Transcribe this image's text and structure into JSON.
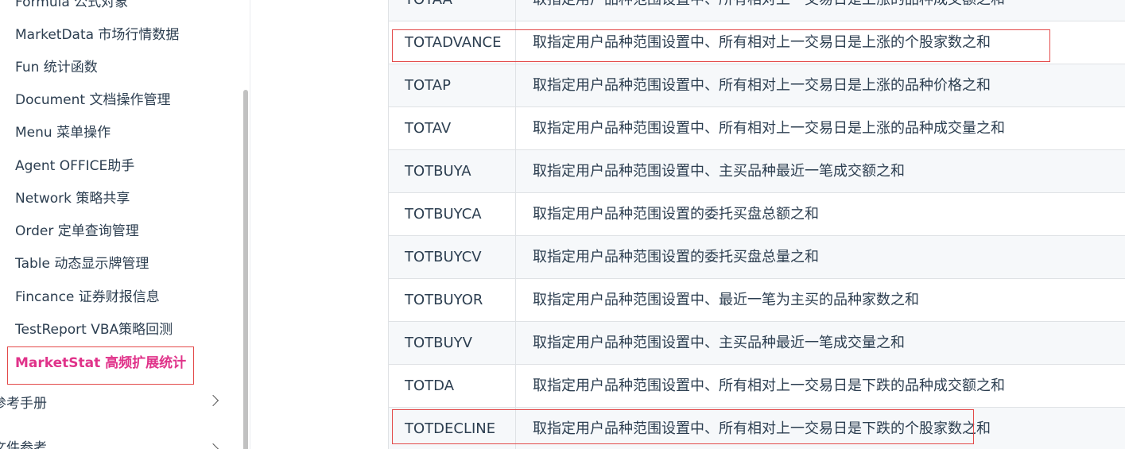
{
  "sidebar": {
    "items": [
      {
        "label": "Formula 公式对象"
      },
      {
        "label": "MarketData 市场行情数据"
      },
      {
        "label": "Fun 统计函数"
      },
      {
        "label": "Document 文档操作管理"
      },
      {
        "label": "Menu 菜单操作"
      },
      {
        "label": "Agent OFFICE助手"
      },
      {
        "label": "Network 策略共享"
      },
      {
        "label": "Order 定单查询管理"
      },
      {
        "label": "Table 动态显示牌管理"
      },
      {
        "label": "Fincance 证券财报信息"
      },
      {
        "label": "TestReport VBA策略回测"
      },
      {
        "label": "MarketStat 高频扩展统计"
      }
    ],
    "groups": [
      {
        "label": "参考手册"
      },
      {
        "label": "文件参考"
      }
    ]
  },
  "table": {
    "rows": [
      {
        "name": "TOTAA",
        "desc": "取指定用户品种范围设置中、所有相对上一交易日是上涨的品种成交额之和"
      },
      {
        "name": "TOTADVANCE",
        "desc": "取指定用户品种范围设置中、所有相对上一交易日是上涨的个股家数之和"
      },
      {
        "name": "TOTAP",
        "desc": "取指定用户品种范围设置中、所有相对上一交易日是上涨的品种价格之和"
      },
      {
        "name": "TOTAV",
        "desc": "取指定用户品种范围设置中、所有相对上一交易日是上涨的品种成交量之和"
      },
      {
        "name": "TOTBUYA",
        "desc": "取指定用户品种范围设置中、主买品种最近一笔成交额之和"
      },
      {
        "name": "TOTBUYCA",
        "desc": "取指定用户品种范围设置的委托买盘总额之和"
      },
      {
        "name": "TOTBUYCV",
        "desc": "取指定用户品种范围设置的委托买盘总量之和"
      },
      {
        "name": "TOTBUYOR",
        "desc": "取指定用户品种范围设置中、最近一笔为主买的品种家数之和"
      },
      {
        "name": "TOTBUYV",
        "desc": "取指定用户品种范围设置中、主买品种最近一笔成交量之和"
      },
      {
        "name": "TOTDA",
        "desc": "取指定用户品种范围设置中、所有相对上一交易日是下跌的品种成交额之和"
      },
      {
        "name": "TOTDECLINE",
        "desc": "取指定用户品种范围设置中、所有相对上一交易日是下跌的个股家数之和"
      }
    ]
  },
  "colors": {
    "active": "#e0338a",
    "highlight_border": "#e34a4a",
    "row_alt": "#f6f8fa",
    "text": "#2c3e50"
  }
}
